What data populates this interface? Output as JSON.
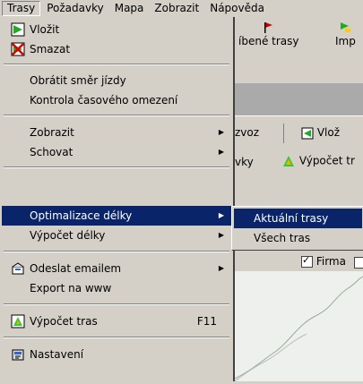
{
  "menubar": {
    "items": [
      {
        "label": "Trasy"
      },
      {
        "label": "Požadavky"
      },
      {
        "label": "Mapa"
      },
      {
        "label": "Zobrazit"
      },
      {
        "label": "Nápověda"
      }
    ]
  },
  "background": {
    "toolbar_buttons": [
      {
        "label": "íbené trasy"
      },
      {
        "label": "Imp"
      }
    ],
    "tab_left": "zvoz",
    "tab_right": "Vlož",
    "row2_left": "vky",
    "row2_right": "Výpočet tr",
    "checkbox_label": "Firma"
  },
  "menu": {
    "vlozit": "Vložit",
    "smazat": "Smazat",
    "obratit": "Obrátit směr jízdy",
    "kontrola": "Kontrola časového omezení",
    "zobrazit": "Zobrazit",
    "schovat": "Schovat",
    "optimalizace": "Optimalizace délky",
    "vypocet_delky": "Výpočet délky",
    "odeslat": "Odeslat emailem",
    "export": "Export na www",
    "vypocet_tras": "Výpočet tras",
    "vypocet_tras_shortcut": "F11",
    "nastaveni": "Nastavení"
  },
  "submenu": {
    "aktualni": "Aktuální trasy",
    "vsech": "Všech tras"
  },
  "colors": {
    "highlight": "#0a246a",
    "face": "#d4d0c8"
  }
}
